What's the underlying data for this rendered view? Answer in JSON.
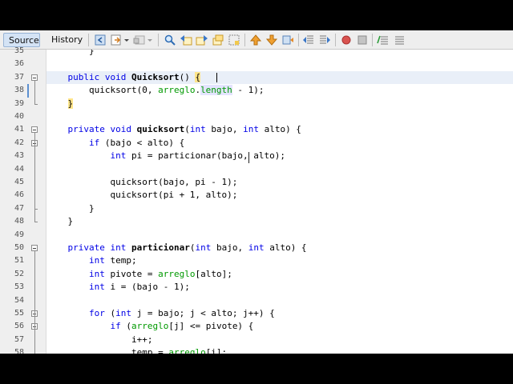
{
  "tabs": {
    "source": "Source",
    "history": "History"
  },
  "colors": {
    "keyword": "#0000e6",
    "field": "#009900",
    "bracket_match": "#ffe58a",
    "current_line": "#e9eff8"
  },
  "toolbar_icons": [
    "last-edit-icon",
    "back-icon",
    "forward-icon",
    "find-icon",
    "find-previous-icon",
    "find-next-icon",
    "find-selection-icon",
    "toggle-highlight-icon",
    "previous-bookmark-icon",
    "next-bookmark-icon",
    "toggle-bookmark-icon",
    "shift-left-icon",
    "shift-right-icon",
    "macro-record-icon",
    "macro-stop-icon",
    "comment-icon",
    "uncomment-icon"
  ],
  "lines": [
    {
      "num": "35",
      "segs": [
        {
          "t": "        }"
        }
      ]
    },
    {
      "num": "36",
      "segs": []
    },
    {
      "num": "37",
      "segs": [
        {
          "t": "    "
        },
        {
          "t": "public void",
          "c": "kw"
        },
        {
          "t": " "
        },
        {
          "t": "Quicksort",
          "c": "fn"
        },
        {
          "t": "() "
        },
        {
          "t": "{",
          "c": "brh"
        }
      ]
    },
    {
      "num": "38",
      "segs": [
        {
          "t": "        quicksort(0, "
        },
        {
          "t": "arreglo",
          "c": "fld"
        },
        {
          "t": "."
        },
        {
          "t": "length",
          "c": "lenh"
        },
        {
          "t": " - 1);"
        }
      ]
    },
    {
      "num": "39",
      "segs": [
        {
          "t": "    "
        },
        {
          "t": "}",
          "c": "brh"
        }
      ]
    },
    {
      "num": "40",
      "segs": []
    },
    {
      "num": "41",
      "segs": [
        {
          "t": "    "
        },
        {
          "t": "private void",
          "c": "kw"
        },
        {
          "t": " "
        },
        {
          "t": "quicksort",
          "c": "fn"
        },
        {
          "t": "("
        },
        {
          "t": "int",
          "c": "kw"
        },
        {
          "t": " bajo, "
        },
        {
          "t": "int",
          "c": "kw"
        },
        {
          "t": " alto) {"
        }
      ]
    },
    {
      "num": "42",
      "segs": [
        {
          "t": "        "
        },
        {
          "t": "if",
          "c": "kw"
        },
        {
          "t": " (bajo < alto) {"
        }
      ]
    },
    {
      "num": "43",
      "segs": [
        {
          "t": "            "
        },
        {
          "t": "int",
          "c": "kw"
        },
        {
          "t": " pi = particionar(bajo, alto);"
        }
      ]
    },
    {
      "num": "44",
      "segs": []
    },
    {
      "num": "45",
      "segs": [
        {
          "t": "            quicksort(bajo, pi - 1);"
        }
      ]
    },
    {
      "num": "46",
      "segs": [
        {
          "t": "            quicksort(pi + 1, alto);"
        }
      ]
    },
    {
      "num": "47",
      "segs": [
        {
          "t": "        }"
        }
      ]
    },
    {
      "num": "48",
      "segs": [
        {
          "t": "    }"
        }
      ]
    },
    {
      "num": "49",
      "segs": []
    },
    {
      "num": "50",
      "segs": [
        {
          "t": "    "
        },
        {
          "t": "private int",
          "c": "kw"
        },
        {
          "t": " "
        },
        {
          "t": "particionar",
          "c": "fn"
        },
        {
          "t": "("
        },
        {
          "t": "int",
          "c": "kw"
        },
        {
          "t": " bajo, "
        },
        {
          "t": "int",
          "c": "kw"
        },
        {
          "t": " alto) {"
        }
      ]
    },
    {
      "num": "51",
      "segs": [
        {
          "t": "        "
        },
        {
          "t": "int",
          "c": "kw"
        },
        {
          "t": " temp;"
        }
      ]
    },
    {
      "num": "52",
      "segs": [
        {
          "t": "        "
        },
        {
          "t": "int",
          "c": "kw"
        },
        {
          "t": " pivote = "
        },
        {
          "t": "arreglo",
          "c": "fld"
        },
        {
          "t": "[alto];"
        }
      ]
    },
    {
      "num": "53",
      "segs": [
        {
          "t": "        "
        },
        {
          "t": "int",
          "c": "kw"
        },
        {
          "t": " i = (bajo - 1);"
        }
      ]
    },
    {
      "num": "54",
      "segs": []
    },
    {
      "num": "55",
      "segs": [
        {
          "t": "        "
        },
        {
          "t": "for",
          "c": "kw"
        },
        {
          "t": " ("
        },
        {
          "t": "int",
          "c": "kw"
        },
        {
          "t": " j = bajo; j < alto; j++) {"
        }
      ]
    },
    {
      "num": "56",
      "segs": [
        {
          "t": "            "
        },
        {
          "t": "if",
          "c": "kw"
        },
        {
          "t": " ("
        },
        {
          "t": "arreglo",
          "c": "fld"
        },
        {
          "t": "[j] <= pivote) {"
        }
      ]
    },
    {
      "num": "57",
      "segs": [
        {
          "t": "                i++;"
        }
      ]
    },
    {
      "num": "58",
      "segs": [
        {
          "t": "                temp = "
        },
        {
          "t": "arreglo",
          "c": "fld"
        },
        {
          "t": "[i];"
        }
      ]
    }
  ]
}
